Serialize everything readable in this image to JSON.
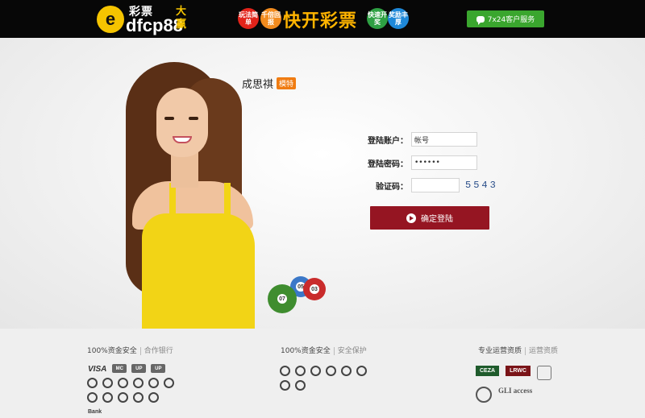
{
  "header": {
    "logo": {
      "brand_en": "dfcp88",
      "brand_cn": "彩票",
      "tagline": "大赢"
    },
    "promo": {
      "title": "快开彩票",
      "badges": [
        "玩法简单",
        "千倍回报",
        "快速开奖",
        "奖励丰厚"
      ]
    },
    "service_button": {
      "label": "7x24客户服务",
      "icon": "chat-icon",
      "color": "#3aa62e"
    }
  },
  "main": {
    "user": {
      "name": "成思祺",
      "badge": "模特"
    },
    "form": {
      "account": {
        "label": "登陆账户：",
        "value": "帐号"
      },
      "password": {
        "label": "登陆密码：",
        "value": "••••••"
      },
      "captcha": {
        "label": "验证码：",
        "value": "",
        "code": "5543"
      },
      "submit": {
        "label": "确定登陆",
        "color": "#951522"
      }
    },
    "lottery_balls": [
      "07",
      "05",
      "03"
    ]
  },
  "footer": {
    "columns": [
      {
        "title": "100%资金安全",
        "subtitle": "合作银行",
        "logos": [
          "VISA",
          "mastercard",
          "UnionPay",
          "银联",
          "bank-icon-1",
          "bank-icon-2",
          "bank-icon-3",
          "bank-icon-4",
          "bank-icon-5",
          "bank-icon-6",
          "Bank"
        ]
      },
      {
        "title": "100%资金安全",
        "subtitle": "安全保护",
        "logos": [
          "kaspersky-icon",
          "norton-icon",
          "mcafee-icon",
          "shield-icon",
          "avast-icon",
          "bitdefender-icon",
          "security-icon-7",
          "security-icon-8"
        ]
      },
      {
        "title": "专业运营资质",
        "subtitle": "运营资质",
        "licenses": [
          "CEZA",
          "LRWC",
          "GLI access"
        ]
      }
    ]
  }
}
